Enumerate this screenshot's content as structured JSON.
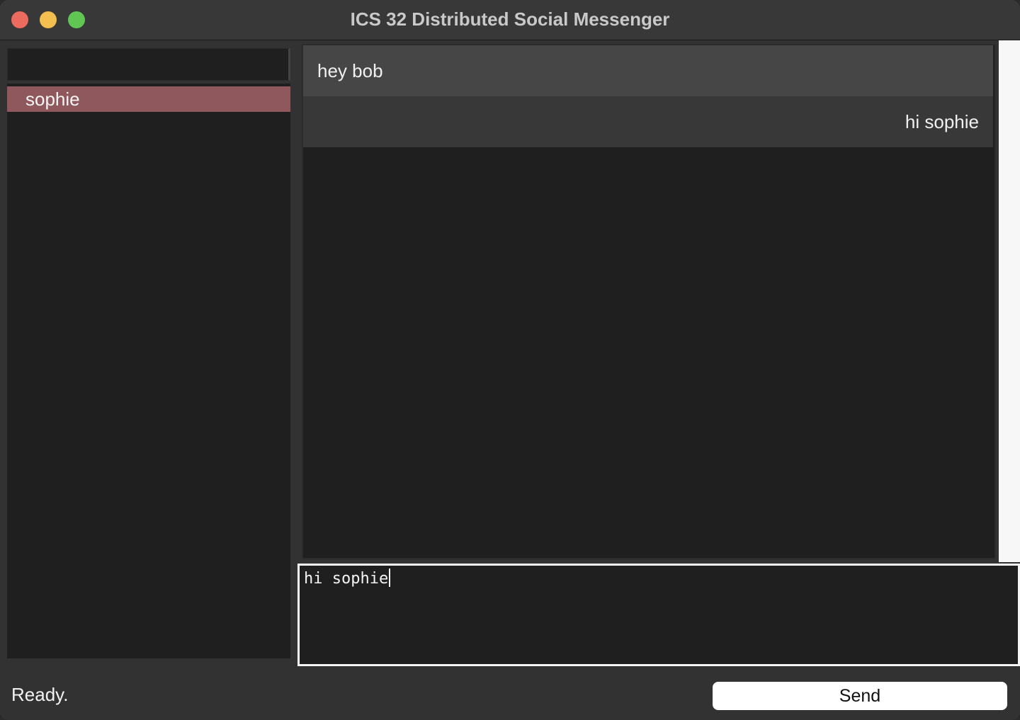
{
  "window": {
    "title": "ICS 32 Distributed Social Messenger"
  },
  "sidebar": {
    "contacts": [
      {
        "name": "sophie",
        "selected": true
      }
    ]
  },
  "conversation": {
    "messages": [
      {
        "text": "hey bob",
        "direction": "incoming"
      },
      {
        "text": "hi sophie",
        "direction": "outgoing"
      }
    ]
  },
  "composer": {
    "value": "hi sophie"
  },
  "footer": {
    "status": "Ready.",
    "send_label": "Send"
  },
  "colors": {
    "selected_contact": "#8e585c",
    "incoming_message": "#464646",
    "outgoing_message": "#383838",
    "close": "#ed6a5e",
    "minimize": "#f5bf4f",
    "maximize": "#61c554"
  }
}
